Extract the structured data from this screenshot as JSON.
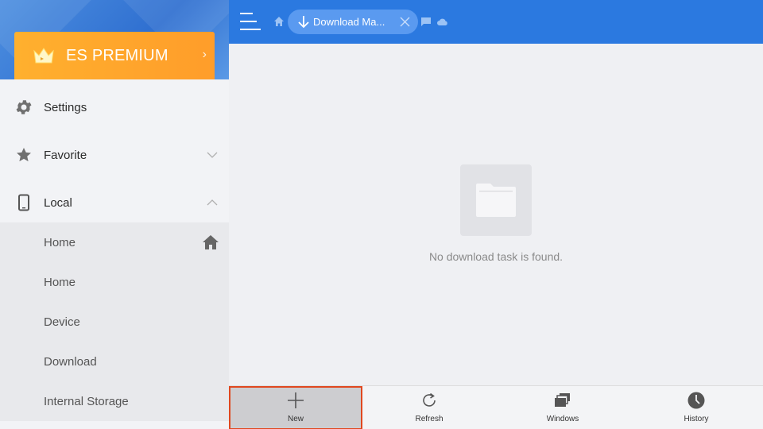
{
  "sidebar": {
    "premium_label": "ES PREMIUM",
    "items": [
      {
        "label": "Settings",
        "icon": "gear-icon"
      },
      {
        "label": "Favorite",
        "icon": "star-icon",
        "chevron": "down"
      },
      {
        "label": "Local",
        "icon": "phone-icon",
        "chevron": "up"
      }
    ],
    "local_items": [
      {
        "label": "Home",
        "icon": "home-icon"
      },
      {
        "label": "Home"
      },
      {
        "label": "Device"
      },
      {
        "label": "Download"
      },
      {
        "label": "Internal Storage"
      }
    ]
  },
  "topbar": {
    "tab_label": "Download Ma...",
    "accent": "#2b79e0"
  },
  "main": {
    "empty_message": "No download task is found."
  },
  "toolbar": {
    "buttons": [
      {
        "label": "New",
        "icon": "plus-icon",
        "selected": true
      },
      {
        "label": "Refresh",
        "icon": "refresh-icon"
      },
      {
        "label": "Windows",
        "icon": "windows-icon"
      },
      {
        "label": "History",
        "icon": "clock-icon"
      }
    ],
    "highlight_color": "#e0481f"
  }
}
